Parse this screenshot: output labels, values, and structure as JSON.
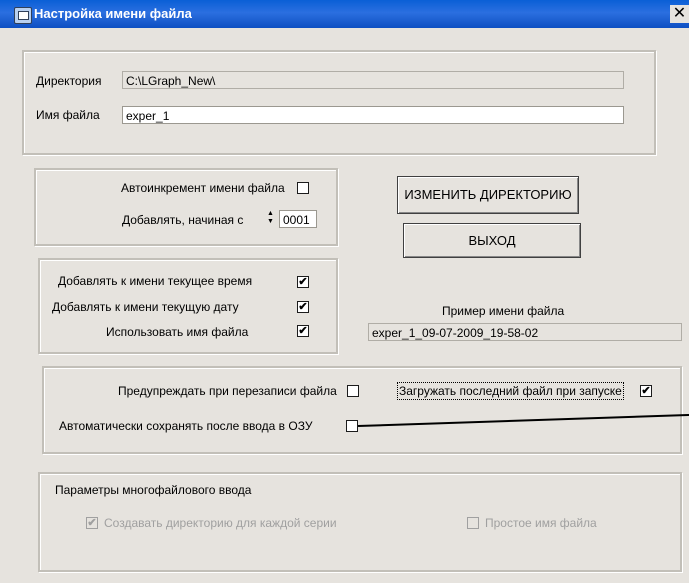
{
  "window": {
    "title": "Настройка имени файла",
    "close_glyph": "✕"
  },
  "directory": {
    "label": "Директория",
    "value": "C:\\LGraph_New\\"
  },
  "filename": {
    "label": "Имя файла",
    "value": "exper_1"
  },
  "autoincrement": {
    "label": "Автоинкремент имени файла",
    "checked": false,
    "start_label": "Добавлять, начиная с",
    "start_value": "0001"
  },
  "buttons": {
    "change_dir": "ИЗМЕНИТЬ ДИРЕКТОРИЮ",
    "exit": "ВЫХОД"
  },
  "append_options": {
    "time_label": "Добавлять к имени текущее время",
    "time_checked": true,
    "date_label": "Добавлять к имени  текущую дату",
    "date_checked": true,
    "use_name_label": "Использовать имя файла",
    "use_name_checked": true
  },
  "example": {
    "label": "Пример имени файла",
    "value": "exper_1_09-07-2009_19-58-02"
  },
  "options": {
    "warn_overwrite_label": "Предупреждать при перезаписи файла",
    "warn_overwrite_checked": false,
    "load_last_label": "Загружать последний файл при запуске",
    "load_last_checked": true,
    "autosave_label": "Автоматически сохранять после ввода в ОЗУ",
    "autosave_checked": false
  },
  "multifile": {
    "title": "Параметры многофайлового ввода",
    "create_dir_label": "Создавать директорию для каждой серии",
    "create_dir_checked": true,
    "simple_name_label": "Простое имя файла",
    "simple_name_checked": false
  },
  "check_glyph": "✔"
}
